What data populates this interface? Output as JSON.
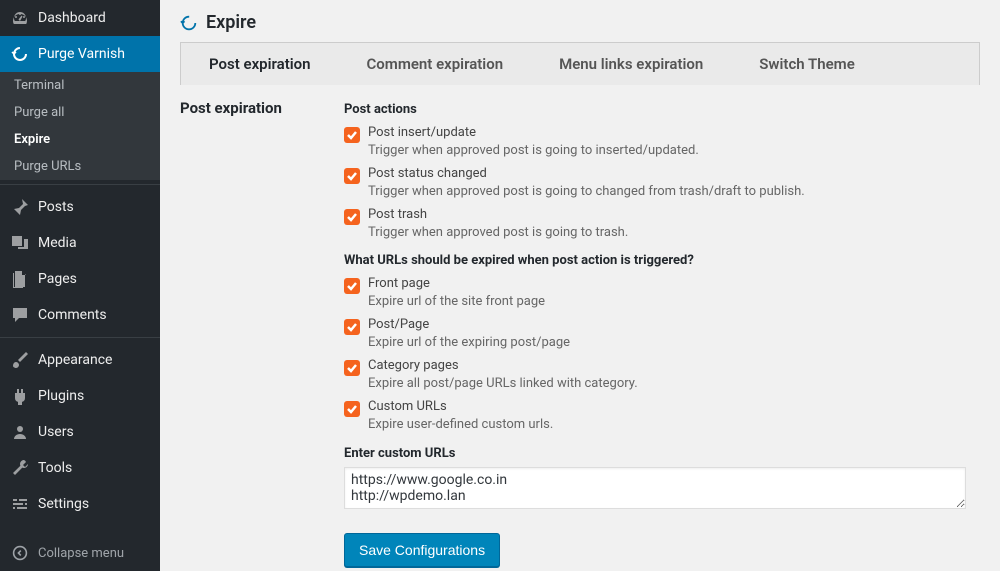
{
  "sidebar": {
    "items": [
      {
        "label": "Dashboard",
        "icon": "dashboard"
      },
      {
        "label": "Purge Varnish",
        "icon": "refresh",
        "active": true
      }
    ],
    "submenu": [
      {
        "label": "Terminal"
      },
      {
        "label": "Purge all"
      },
      {
        "label": "Expire",
        "active": true
      },
      {
        "label": "Purge URLs"
      }
    ],
    "items2": [
      {
        "label": "Posts",
        "icon": "pin"
      },
      {
        "label": "Media",
        "icon": "media"
      },
      {
        "label": "Pages",
        "icon": "page"
      },
      {
        "label": "Comments",
        "icon": "comment"
      }
    ],
    "items3": [
      {
        "label": "Appearance",
        "icon": "brush"
      },
      {
        "label": "Plugins",
        "icon": "plug"
      },
      {
        "label": "Users",
        "icon": "user"
      },
      {
        "label": "Tools",
        "icon": "wrench"
      },
      {
        "label": "Settings",
        "icon": "sliders"
      }
    ],
    "collapse": "Collapse menu"
  },
  "page": {
    "title": "Expire",
    "tabs": [
      "Post expiration",
      "Comment expiration",
      "Menu links expiration",
      "Switch Theme"
    ],
    "section_label": "Post expiration",
    "post_actions_title": "Post actions",
    "post_actions": [
      {
        "label": "Post insert/update",
        "desc": "Trigger when approved post is going to inserted/updated."
      },
      {
        "label": "Post status changed",
        "desc": "Trigger when approved post is going to changed from trash/draft to publish."
      },
      {
        "label": "Post trash",
        "desc": "Trigger when approved post is going to trash."
      }
    ],
    "urls_title": "What URLs should be expired when post action is triggered?",
    "url_opts": [
      {
        "label": "Front page",
        "desc": "Expire url of the site front page"
      },
      {
        "label": "Post/Page",
        "desc": "Expire url of the expiring post/page"
      },
      {
        "label": "Category pages",
        "desc": "Expire all post/page URLs linked with category."
      },
      {
        "label": "Custom URLs",
        "desc": "Expire user-defined custom urls."
      }
    ],
    "custom_urls_label": "Enter custom URLs",
    "custom_urls_value": "https://www.google.co.in\nhttp://wpdemo.lan",
    "save_label": "Save Configurations"
  }
}
